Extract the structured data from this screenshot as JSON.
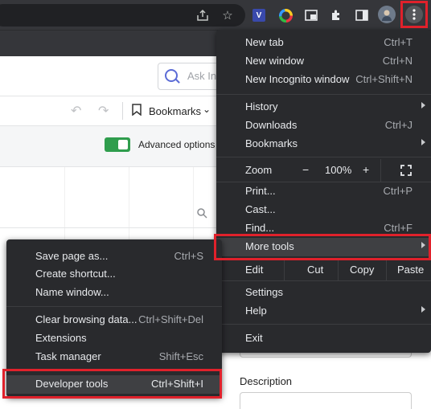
{
  "page": {
    "search_placeholder": "Ask Ins",
    "bookmarks_label": "Bookmarks",
    "advanced_options": "Advanced options",
    "description_label": "Description"
  },
  "main_menu": {
    "group1": [
      {
        "label": "New tab",
        "shortcut": "Ctrl+T"
      },
      {
        "label": "New window",
        "shortcut": "Ctrl+N"
      },
      {
        "label": "New Incognito window",
        "shortcut": "Ctrl+Shift+N"
      }
    ],
    "group2": [
      {
        "label": "History",
        "shortcut": ""
      },
      {
        "label": "Downloads",
        "shortcut": "Ctrl+J"
      },
      {
        "label": "Bookmarks",
        "shortcut": ""
      }
    ],
    "zoom": {
      "label": "Zoom",
      "minus": "−",
      "value": "100%",
      "plus": "+"
    },
    "group3": [
      {
        "label": "Print...",
        "shortcut": "Ctrl+P"
      },
      {
        "label": "Cast...",
        "shortcut": ""
      },
      {
        "label": "Find...",
        "shortcut": "Ctrl+F"
      },
      {
        "label": "More tools",
        "shortcut": ""
      }
    ],
    "edit": {
      "label": "Edit",
      "cut": "Cut",
      "copy": "Copy",
      "paste": "Paste"
    },
    "group4": [
      {
        "label": "Settings"
      },
      {
        "label": "Help"
      }
    ],
    "exit": "Exit"
  },
  "more_tools_menu": {
    "group1": [
      {
        "label": "Save page as...",
        "shortcut": "Ctrl+S"
      },
      {
        "label": "Create shortcut...",
        "shortcut": ""
      },
      {
        "label": "Name window...",
        "shortcut": ""
      }
    ],
    "group2": [
      {
        "label": "Clear browsing data...",
        "shortcut": "Ctrl+Shift+Del"
      },
      {
        "label": "Extensions",
        "shortcut": ""
      },
      {
        "label": "Task manager",
        "shortcut": "Shift+Esc"
      }
    ],
    "developer_tools": {
      "label": "Developer tools",
      "shortcut": "Ctrl+Shift+I"
    }
  },
  "colors": {
    "highlight": "#e0212b",
    "toggle_on": "#2f9d4d",
    "menu_bg": "#292a2d"
  },
  "icons": [
    "share-icon",
    "star-icon",
    "extension-icon",
    "color-wheel-icon",
    "window-icon",
    "puzzle-icon",
    "sidepanel-icon",
    "profile-avatar",
    "kebab-menu-icon",
    "search-icon",
    "undo-icon",
    "redo-icon",
    "bookmark-icon",
    "fullscreen-icon"
  ]
}
